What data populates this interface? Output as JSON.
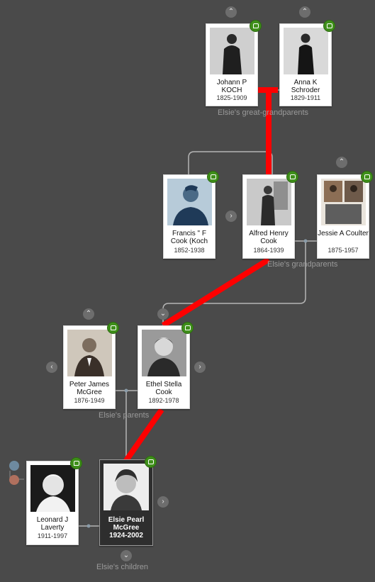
{
  "people": {
    "johann": {
      "name": "Johann P KOCH",
      "dates": "1825-1909"
    },
    "anna": {
      "name": "Anna K Schroder",
      "dates": "1829-1911"
    },
    "francis": {
      "name": "Francis \" F Cook (Koch",
      "dates": "1852-1938"
    },
    "alfred": {
      "name": "Alfred Henry Cook",
      "dates": "1864-1939"
    },
    "jessie": {
      "name": "Jessie A Coulter",
      "dates": "1875-1957"
    },
    "peter": {
      "name": "Peter James McGree",
      "dates": "1876-1949"
    },
    "ethel": {
      "name": "Ethel Stella Cook",
      "dates": "1892-1978"
    },
    "leonard": {
      "name": "Leonard J Laverty",
      "dates": "1911-1997"
    },
    "elsie": {
      "name": "Elsie Pearl McGree",
      "dates": "1924-2002"
    }
  },
  "labels": {
    "great_grandparents": "Elsie's great-grandparents",
    "grandparents": "Elsie's grandparents",
    "parents": "Elsie's parents",
    "children": "Elsie's children"
  },
  "icons": {
    "expand_up": "chevron-up-icon",
    "expand_down": "chevron-down-icon",
    "expand_left": "chevron-left-icon",
    "expand_right": "chevron-right-icon",
    "hint": "record-hint-leaf-icon"
  },
  "colors": {
    "background": "#4a4a4a",
    "card": "#ffffff",
    "focus_card": "#2e2e2e",
    "connector": "#b5b5b5",
    "highlight_path": "#ff0000",
    "hint_badge": "#3f8f1a",
    "spouse_link": "#c97a6a"
  }
}
